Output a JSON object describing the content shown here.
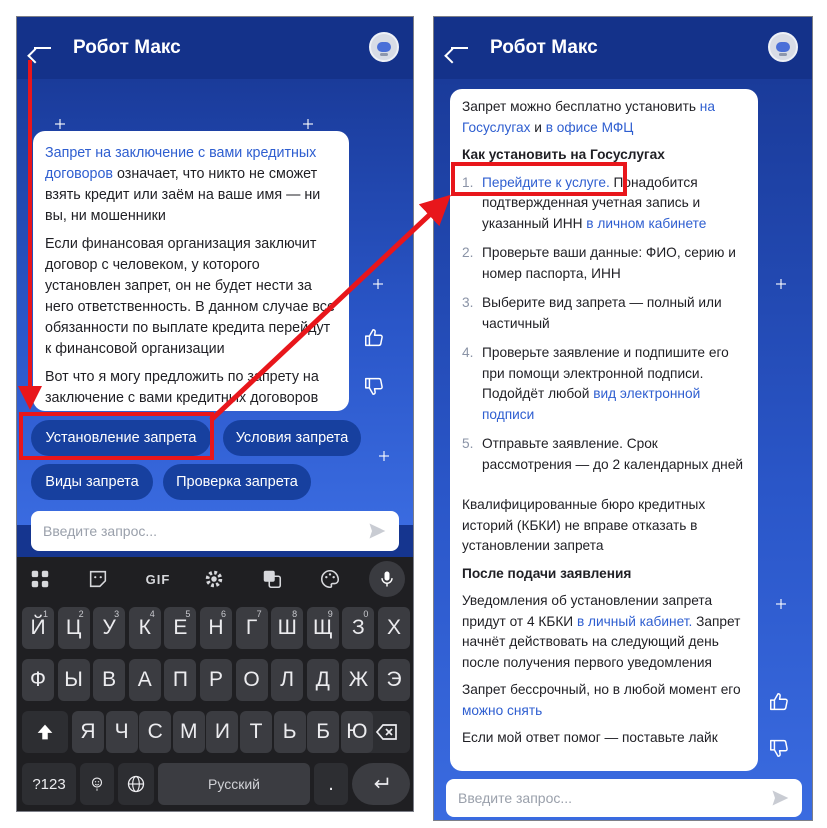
{
  "app": {
    "title": "Робот Макс"
  },
  "left": {
    "message": {
      "p1_link": "Запрет на заключение с вами кредитных договоров",
      "p1_rest": " означает, что никто не сможет взять кредит или заём на ваше имя — ни вы, ни мошенники",
      "p2": "Если финансовая организация заключит договор с человеком, у которого установлен запрет, он не будет нести за него ответственность. В данном случае все обязанности по выплате кредита перейдут к финансовой организации",
      "p3": "Вот что я могу предложить по запрету на заключение с вами кредитных договоров"
    },
    "chips": [
      "Установление запрета",
      "Условия запрета",
      "Виды запрета",
      "Проверка запрета"
    ],
    "input_placeholder": "Введите запрос..."
  },
  "keyboard": {
    "toolbar": {
      "gif": "GIF"
    },
    "row1": [
      {
        "key": "Й",
        "hint": "1"
      },
      {
        "key": "Ц",
        "hint": "2"
      },
      {
        "key": "У",
        "hint": "3"
      },
      {
        "key": "К",
        "hint": "4"
      },
      {
        "key": "Е",
        "hint": "5"
      },
      {
        "key": "Н",
        "hint": "6"
      },
      {
        "key": "Г",
        "hint": "7"
      },
      {
        "key": "Ш",
        "hint": "8"
      },
      {
        "key": "Щ",
        "hint": "9"
      },
      {
        "key": "З",
        "hint": "0"
      },
      {
        "key": "Х",
        "hint": ""
      }
    ],
    "row2": [
      "Ф",
      "Ы",
      "В",
      "А",
      "П",
      "Р",
      "О",
      "Л",
      "Д",
      "Ж",
      "Э"
    ],
    "row3": [
      "Я",
      "Ч",
      "С",
      "М",
      "И",
      "Т",
      "Ь",
      "Б",
      "Ю"
    ],
    "numbers_key": "?123",
    "space_label": "Русский",
    "period_key": "."
  },
  "right": {
    "intro_pre": "Запрет можно бесплатно установить ",
    "intro_link1": "на Госуслугах",
    "intro_mid": " и ",
    "intro_link2": "в офисе МФЦ",
    "section1_title": "Как установить на Госуслугах",
    "steps": [
      {
        "num": "1.",
        "link": "Перейдите к услуге.",
        "text": " Понадобится подтвержденная учетная запись и указанный ИНН ",
        "link2": "в личном кабинете",
        "text2": ""
      },
      {
        "num": "2.",
        "link": "",
        "text": "Проверьте ваши данные: ФИО, серию и номер паспорта, ИНН",
        "link2": "",
        "text2": ""
      },
      {
        "num": "3.",
        "link": "",
        "text": "Выберите вид запрета — полный или частичный",
        "link2": "",
        "text2": ""
      },
      {
        "num": "4.",
        "link": "",
        "text": "Проверьте заявление и подпишите его при помощи электронной подписи. Подойдёт любой ",
        "link2": "вид электронной подписи",
        "text2": ""
      },
      {
        "num": "5.",
        "link": "",
        "text": "Отправьте заявление. Срок рассмотрения — до 2 календарных дней",
        "link2": "",
        "text2": ""
      }
    ],
    "p_kbki": "Квалифицированные бюро кредитных историй (КБКИ) не вправе отказать в установлении запрета",
    "section2_title": "После подачи заявления",
    "p_notify_pre": "Уведомления об установлении запрета придут от 4 КБКИ ",
    "p_notify_link": "в личный кабинет.",
    "p_notify_post": " Запрет начнёт действовать на следующий день после получения первого уведомления",
    "p_perm_pre": "Запрет бессрочный, но в любой момент его ",
    "p_perm_link": "можно снять",
    "p_like": "Если мой ответ помог — поставьте лайк",
    "input_placeholder": "Введите запрос..."
  },
  "colors": {
    "accent": "#2e5ed0",
    "chip": "#17409f",
    "annotation": "#e8161b"
  }
}
